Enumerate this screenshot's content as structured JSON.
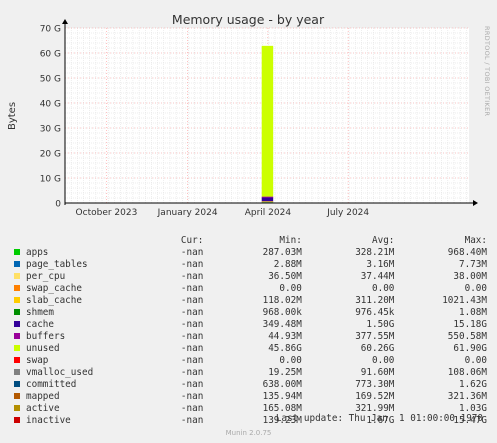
{
  "watermark": "RRDTOOL / TOBI OETIKER",
  "footer": "Munin 2.0.75",
  "last_update": "Last update: Thu Jan  1 01:00:00 1970",
  "legend": {
    "headers": {
      "cur": "Cur:",
      "min": "Min:",
      "avg": "Avg:",
      "max": "Max:"
    },
    "rows": [
      {
        "name": "apps",
        "color": "#00cc00",
        "cur": "-nan",
        "min": "287.03M",
        "avg": "328.21M",
        "max": "968.40M"
      },
      {
        "name": "page_tables",
        "color": "#0066b3",
        "cur": "-nan",
        "min": "2.88M",
        "avg": "3.16M",
        "max": "7.73M"
      },
      {
        "name": "per_cpu",
        "color": "#ffe066",
        "cur": "-nan",
        "min": "36.50M",
        "avg": "37.44M",
        "max": "38.00M"
      },
      {
        "name": "swap_cache",
        "color": "#ff8000",
        "cur": "-nan",
        "min": "0.00",
        "avg": "0.00",
        "max": "0.00"
      },
      {
        "name": "slab_cache",
        "color": "#ffcc00",
        "cur": "-nan",
        "min": "118.02M",
        "avg": "311.20M",
        "max": "1021.43M"
      },
      {
        "name": "shmem",
        "color": "#008f00",
        "cur": "-nan",
        "min": "968.00k",
        "avg": "976.45k",
        "max": "1.08M"
      },
      {
        "name": "cache",
        "color": "#330099",
        "cur": "-nan",
        "min": "349.48M",
        "avg": "1.50G",
        "max": "15.18G"
      },
      {
        "name": "buffers",
        "color": "#990099",
        "cur": "-nan",
        "min": "44.93M",
        "avg": "377.55M",
        "max": "550.58M"
      },
      {
        "name": "unused",
        "color": "#ccff00",
        "cur": "-nan",
        "min": "45.86G",
        "avg": "60.26G",
        "max": "61.90G"
      },
      {
        "name": "swap",
        "color": "#ff0000",
        "cur": "-nan",
        "min": "0.00",
        "avg": "0.00",
        "max": "0.00"
      },
      {
        "name": "vmalloc_used",
        "color": "#808080",
        "cur": "-nan",
        "min": "19.25M",
        "avg": "91.60M",
        "max": "108.06M"
      },
      {
        "name": "committed",
        "color": "#004d80",
        "cur": "-nan",
        "min": "638.00M",
        "avg": "773.30M",
        "max": "1.62G"
      },
      {
        "name": "mapped",
        "color": "#b35900",
        "cur": "-nan",
        "min": "135.94M",
        "avg": "169.52M",
        "max": "321.36M"
      },
      {
        "name": "active",
        "color": "#b38f00",
        "cur": "-nan",
        "min": "165.08M",
        "avg": "321.99M",
        "max": "1.03G"
      },
      {
        "name": "inactive",
        "color": "#cc0000",
        "cur": "-nan",
        "min": "139.23M",
        "avg": "1.67G",
        "max": "15.47G"
      }
    ]
  },
  "chart_data": {
    "type": "area",
    "title": "Memory usage - by year",
    "ylabel": "Bytes",
    "ylim": [
      0,
      70
    ],
    "yunit": "G",
    "yticks": [
      0,
      10,
      20,
      30,
      40,
      50,
      60,
      70
    ],
    "ytick_labels": [
      "0",
      "10 G",
      "20 G",
      "30 G",
      "40 G",
      "50 G",
      "60 G",
      "70 G"
    ],
    "xlim": [
      "2023-08-15",
      "2024-11-15"
    ],
    "xticks": [
      "2023-10-01",
      "2024-01-01",
      "2024-04-01",
      "2024-07-01"
    ],
    "xtick_labels": [
      "October 2023",
      "January 2024",
      "April 2024",
      "July 2024"
    ],
    "grid": true,
    "data_span": {
      "start": "2024-03-25",
      "end": "2024-04-07"
    },
    "stack_at_peak": [
      {
        "series": "apps",
        "value": 0.33
      },
      {
        "series": "page_tables",
        "value": 0.003
      },
      {
        "series": "per_cpu",
        "value": 0.04
      },
      {
        "series": "slab_cache",
        "value": 0.31
      },
      {
        "series": "cache",
        "value": 1.5
      },
      {
        "series": "buffers",
        "value": 0.38
      },
      {
        "series": "unused",
        "value": 60.3
      }
    ],
    "colors": {
      "axis": "#000000",
      "grid_major": "#ff9999",
      "grid_minor": "#dddddd",
      "plot_bg": "#ffffff"
    }
  }
}
